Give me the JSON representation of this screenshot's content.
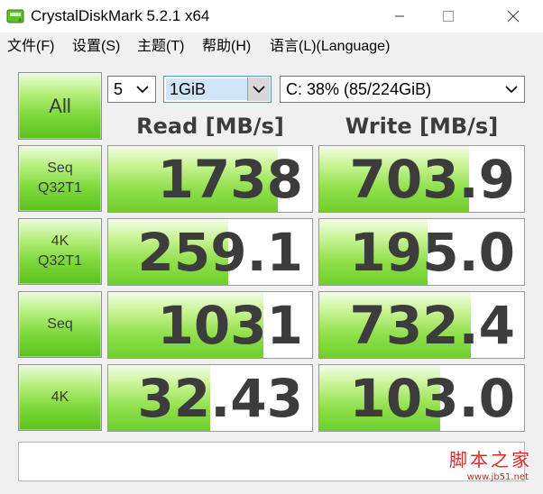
{
  "window": {
    "title": "CrystalDiskMark 5.2.1 x64"
  },
  "menu": [
    {
      "label": "文件(F)"
    },
    {
      "label": "设置(S)"
    },
    {
      "label": "主题(T)"
    },
    {
      "label": "帮助(H)"
    },
    {
      "label": "语言(L)(Language)"
    }
  ],
  "controls": {
    "all_label": "All",
    "count": "5",
    "size": "1GiB",
    "drive": "C: 38% (85/224GiB)"
  },
  "headers": {
    "read": "Read [MB/s]",
    "write": "Write [MB/s]"
  },
  "tests": [
    {
      "line1": "Seq",
      "line2": "Q32T1",
      "read": "1738",
      "write": "703.9",
      "read_fraction": 0.83,
      "write_fraction": 0.73
    },
    {
      "line1": "4K",
      "line2": "Q32T1",
      "read": "259.1",
      "write": "195.0",
      "read_fraction": 0.59,
      "write_fraction": 0.53
    },
    {
      "line1": "Seq",
      "line2": "",
      "read": "1031",
      "write": "732.4",
      "read_fraction": 0.76,
      "write_fraction": 0.74
    },
    {
      "line1": "4K",
      "line2": "",
      "read": "32.43",
      "write": "103.0",
      "read_fraction": 0.5,
      "write_fraction": 0.59
    }
  ],
  "status": "",
  "watermark": {
    "text": "脚本之家",
    "url": "www.jb51.net"
  },
  "colors": {
    "accent_green": "#7dd83a",
    "value_text": "#3c3c3c",
    "watermark_red": "#d62b2b"
  }
}
